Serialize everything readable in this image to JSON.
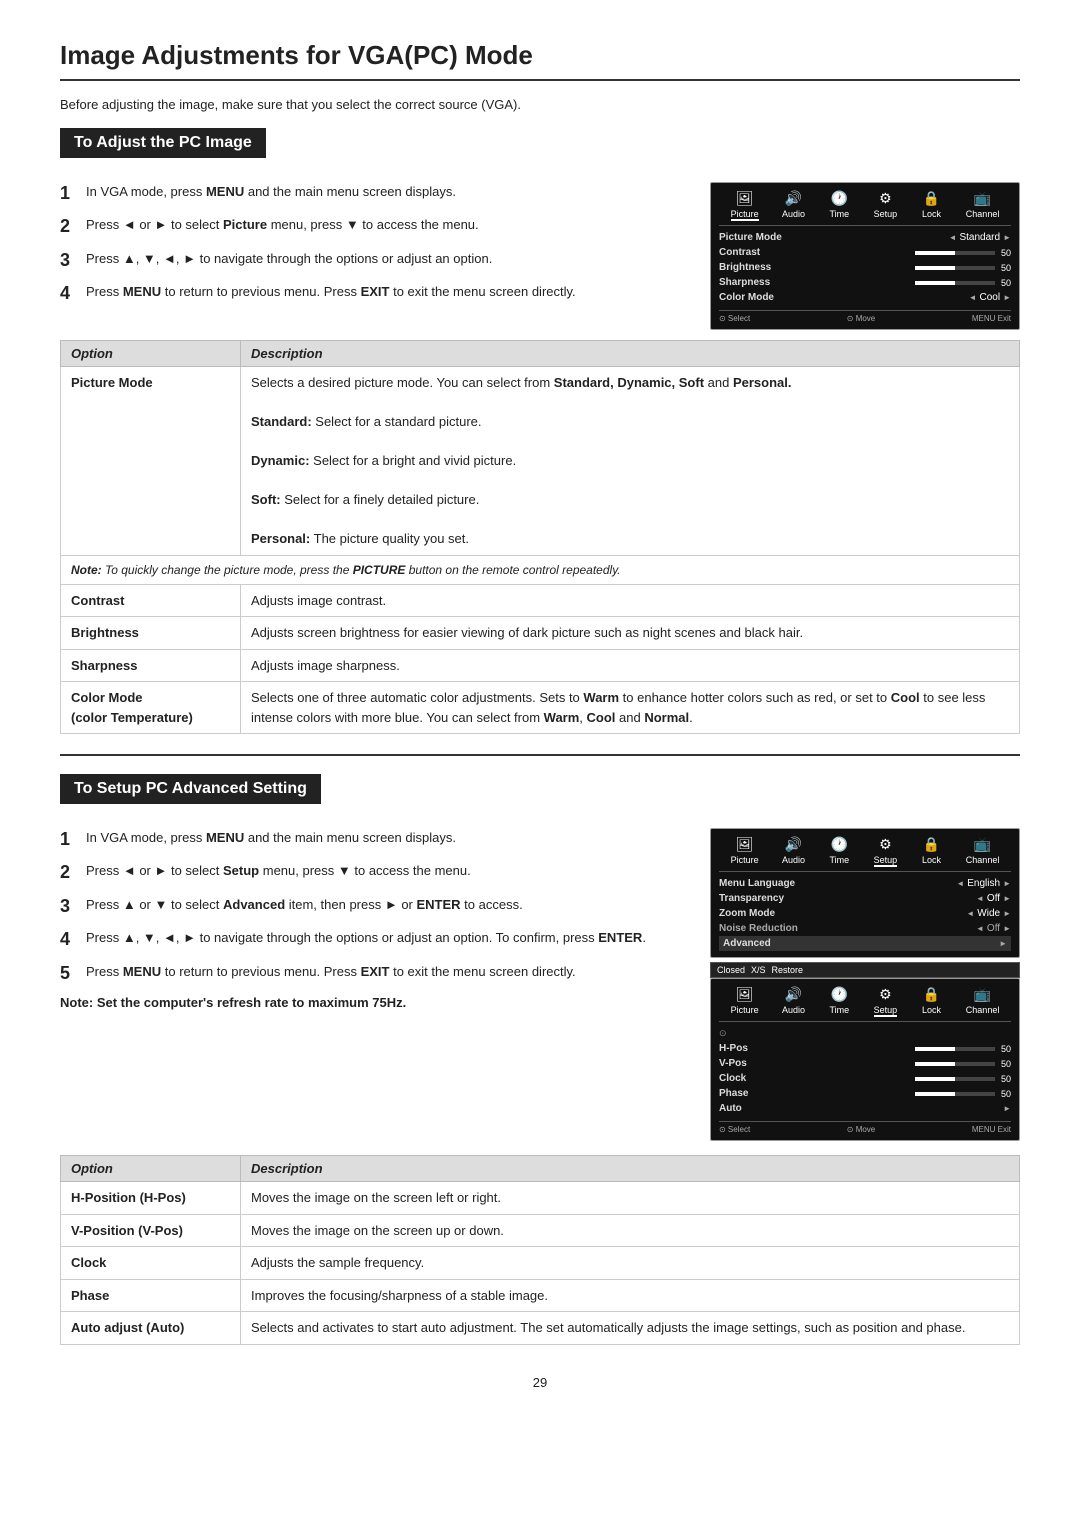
{
  "page": {
    "title": "Image Adjustments for VGA(PC) Mode",
    "number": "29",
    "intro": "Before adjusting the image, make sure that you select the correct source (VGA)."
  },
  "section1": {
    "heading": "To Adjust the PC Image",
    "steps": [
      {
        "num": "1",
        "text": "In VGA mode, press <b>MENU</b> and the main menu screen displays."
      },
      {
        "num": "2",
        "text": "Press ◄ or ► to select <b>Picture</b> menu, press ▼ to access the menu."
      },
      {
        "num": "3",
        "text": "Press ▲, ▼, ◄, ► to navigate through the options or adjust an option."
      },
      {
        "num": "4",
        "text": "Press <b>MENU</b> to return to previous menu. Press <b>EXIT</b> to exit the menu screen directly."
      }
    ],
    "menu": {
      "icons": [
        {
          "label": "Picture",
          "active": true,
          "icon": "🖼"
        },
        {
          "label": "Audio",
          "active": false,
          "icon": "🔊"
        },
        {
          "label": "Time",
          "active": false,
          "icon": "🕐"
        },
        {
          "label": "Setup",
          "active": false,
          "icon": "⚙"
        },
        {
          "label": "Lock",
          "active": false,
          "icon": "🔒"
        },
        {
          "label": "Channel",
          "active": false,
          "icon": "📺"
        }
      ],
      "rows": [
        {
          "label": "Picture Mode",
          "type": "arrows",
          "value": "Standard"
        },
        {
          "label": "Contrast",
          "type": "bar",
          "value": 50
        },
        {
          "label": "Brightness",
          "type": "bar",
          "value": 50
        },
        {
          "label": "Sharpness",
          "type": "bar",
          "value": 50
        },
        {
          "label": "Color Mode",
          "type": "arrows",
          "value": "Cool"
        }
      ],
      "footer": [
        "⊙ Select",
        "⊙ Move",
        "MENU Exit"
      ]
    },
    "options_header": [
      "Option",
      "Description"
    ],
    "options": [
      {
        "name": "Picture Mode",
        "desc_lines": [
          "Selects a desired picture mode. You can select from <b>Standard, Dynamic, Soft</b> and <b>Personal.</b>",
          "<b>Standard:</b> Select for a standard picture.",
          "<b>Dynamic:</b> Select for a bright and vivid picture.",
          "<b>Soft:</b> Select for a finely detailed picture.",
          "<b>Personal:</b> The picture quality you set."
        ]
      },
      {
        "note": "<i><b>Note:</b> To quickly change the picture mode, press the <b>PICTURE</b> button on the remote control repeatedly.</i>"
      },
      {
        "name": "Contrast",
        "desc_lines": [
          "Adjusts image contrast."
        ]
      },
      {
        "name": "Brightness",
        "desc_lines": [
          "Adjusts screen brightness for easier viewing of dark picture such as night scenes and black hair."
        ]
      },
      {
        "name": "Sharpness",
        "desc_lines": [
          "Adjusts image sharpness."
        ]
      },
      {
        "name": "Color Mode\n(color Temperature)",
        "desc_lines": [
          "Selects one of three automatic color adjustments. Sets to <b>Warm</b> to enhance hotter colors such as red, or set to <b>Cool</b> to see less intense colors with more blue. You can select from <b>Warm</b>, <b>Cool</b> and <b>Normal</b>."
        ]
      }
    ]
  },
  "section2": {
    "heading": "To Setup PC Advanced Setting",
    "steps": [
      {
        "num": "1",
        "text": "In VGA mode, press <b>MENU</b> and the main menu screen displays."
      },
      {
        "num": "2",
        "text": "Press ◄ or ► to select <b>Setup</b> menu, press ▼ to access the menu."
      },
      {
        "num": "3",
        "text": "Press ▲ or ▼ to select <b>Advanced</b> item, then press ► or <b>ENTER</b> to access."
      },
      {
        "num": "4",
        "text": "Press ▲, ▼, ◄, ► to navigate through the options or adjust an option. To confirm, press <b>ENTER</b>."
      },
      {
        "num": "5",
        "text": "Press <b>MENU</b> to return to previous menu. Press <b>EXIT</b> to exit the menu screen directly."
      }
    ],
    "note_refresh": "Note: Set the computer's refresh rate to maximum 75Hz.",
    "menu_setup": {
      "icons": [
        {
          "label": "Picture",
          "active": false,
          "icon": "🖼"
        },
        {
          "label": "Audio",
          "active": false,
          "icon": "🔊"
        },
        {
          "label": "Time",
          "active": false,
          "icon": "🕐"
        },
        {
          "label": "Setup",
          "active": true,
          "icon": "⚙"
        },
        {
          "label": "Lock",
          "active": false,
          "icon": "🔒"
        },
        {
          "label": "Channel",
          "active": false,
          "icon": "📺"
        }
      ],
      "rows": [
        {
          "label": "Menu Language",
          "type": "arrows",
          "value": "English"
        },
        {
          "label": "Transparency",
          "type": "arrows",
          "value": "Off"
        },
        {
          "label": "Zoom Mode",
          "type": "arrows",
          "value": "Wide"
        },
        {
          "label": "Noise Reduction",
          "type": "arrows",
          "value": "Off"
        },
        {
          "label": "Advanced",
          "type": "arrow-right",
          "value": ""
        }
      ]
    },
    "menu_advanced": {
      "extra_rows_top": [
        {
          "label": "Closed",
          "type": "text"
        },
        {
          "label": "X/S",
          "type": "text"
        },
        {
          "label": "Restore",
          "type": "text"
        }
      ],
      "icons": [
        {
          "label": "Picture",
          "active": false,
          "icon": "🖼"
        },
        {
          "label": "Audio",
          "active": false,
          "icon": "🔊"
        },
        {
          "label": "Time",
          "active": false,
          "icon": "🕐"
        },
        {
          "label": "Setup",
          "active": true,
          "icon": "⚙"
        },
        {
          "label": "Lock",
          "active": false,
          "icon": "🔒"
        },
        {
          "label": "Channel",
          "active": false,
          "icon": "📺"
        }
      ],
      "rows": [
        {
          "label": "H-Pos",
          "type": "bar",
          "value": 50
        },
        {
          "label": "V-Pos",
          "type": "bar",
          "value": 50
        },
        {
          "label": "Clock",
          "type": "bar",
          "value": 50
        },
        {
          "label": "Phase",
          "type": "bar",
          "value": 50
        },
        {
          "label": "Auto",
          "type": "arrow-right",
          "value": ""
        }
      ],
      "footer": [
        "⊙ Select",
        "⊙ Move",
        "MENU Exit"
      ]
    },
    "options_header": [
      "Option",
      "Description"
    ],
    "options": [
      {
        "name": "H-Position (H-Pos)",
        "desc_lines": [
          "Moves the image on the screen left or right."
        ]
      },
      {
        "name": "V-Position (V-Pos)",
        "desc_lines": [
          "Moves the image on the screen up or down."
        ]
      },
      {
        "name": "Clock",
        "desc_lines": [
          "Adjusts the sample frequency."
        ]
      },
      {
        "name": "Phase",
        "desc_lines": [
          "Improves the focusing/sharpness of a stable image."
        ]
      },
      {
        "name": "Auto adjust (Auto)",
        "desc_lines": [
          "Selects and activates to start auto adjustment. The set automatically adjusts the image settings, such as position and phase."
        ]
      }
    ]
  }
}
